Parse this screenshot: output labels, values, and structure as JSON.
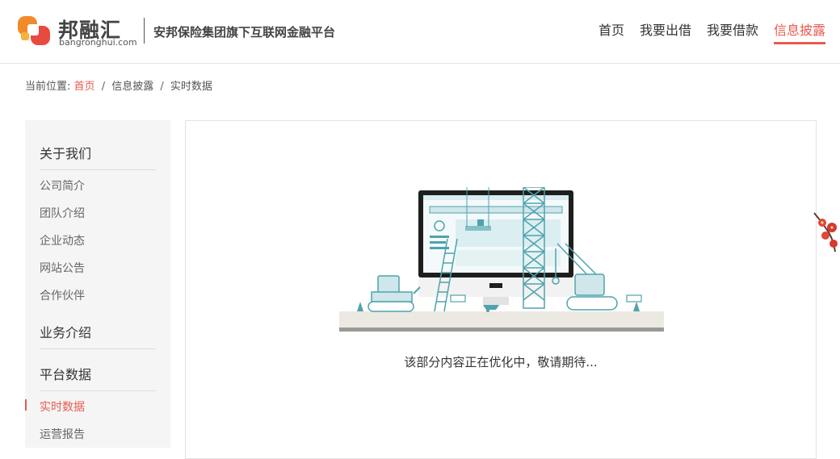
{
  "header": {
    "logo_cn": "邦融汇",
    "logo_en": "bangronghui.com",
    "slogan": "安邦保险集团旗下互联网金融平台",
    "nav": [
      {
        "label": "首页"
      },
      {
        "label": "我要出借"
      },
      {
        "label": "我要借款"
      },
      {
        "label": "信息披露"
      }
    ]
  },
  "breadcrumb": {
    "prefix": "当前位置:",
    "home": "首页",
    "sep": "/",
    "level2": "信息披露",
    "level3": "实时数据"
  },
  "sidebar": {
    "groups": [
      {
        "label": "关于我们",
        "items": [
          "公司简介",
          "团队介绍",
          "企业动态",
          "网站公告",
          "合作伙伴"
        ]
      },
      {
        "label": "业务介绍",
        "items": []
      },
      {
        "label": "平台数据",
        "items": [
          "实时数据",
          "运营报告"
        ]
      }
    ]
  },
  "content": {
    "message": "该部分内容正在优化中，敬请期待...",
    "illustration_icon": "under-construction-illustration"
  },
  "colors": {
    "accent": "#e85a4f",
    "teal": "#4fa3ad",
    "sidebar_bg": "#f5f5f5"
  }
}
